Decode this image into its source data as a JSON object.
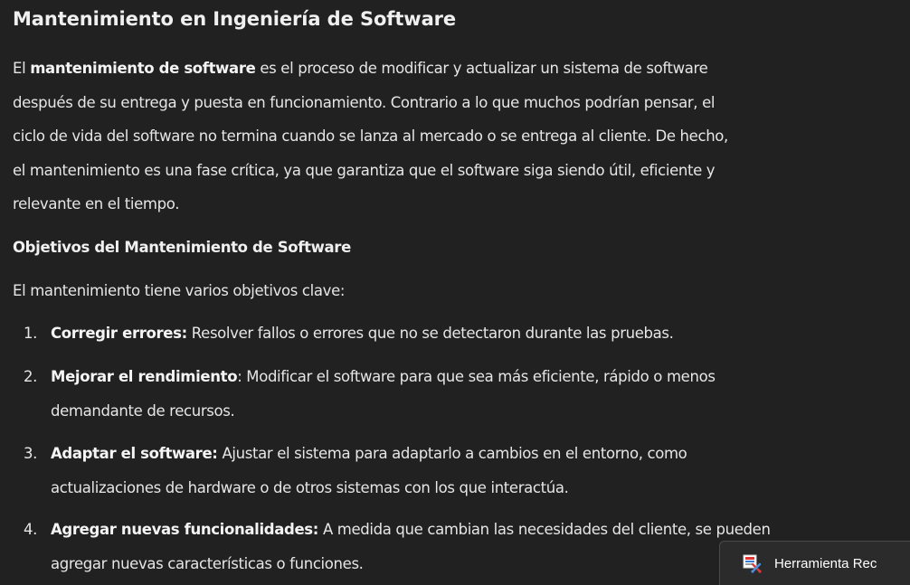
{
  "title": "Mantenimiento en Ingeniería de Software",
  "intro": {
    "line1_pre": "El ",
    "line1_bold": "mantenimiento de software",
    "line1_post": " es el proceso de modificar y actualizar un sistema de software",
    "line2": "después de su entrega y puesta en funcionamiento. Contrario a lo que muchos podrían pensar, el",
    "line3": "ciclo de vida del software no termina cuando se lanza al mercado o se entrega al cliente. De hecho,",
    "line4": "el mantenimiento es una fase crítica, ya que garantiza que el software siga siendo útil, eficiente y",
    "line5": "relevante en el tiempo."
  },
  "objectives": {
    "heading": "Objetivos del Mantenimiento de Software",
    "lead": "El mantenimiento tiene varios objetivos clave:",
    "items": [
      {
        "number": "1.",
        "title": "Corregir errores:",
        "lines": [
          "Resolver fallos o errores que no se detectaron durante las pruebas."
        ]
      },
      {
        "number": "2.",
        "title": "Mejorar el rendimiento",
        "lines": [
          ": Modificar el software para que sea más eficiente, rápido o menos",
          "demandante de recursos."
        ]
      },
      {
        "number": "3.",
        "title": "Adaptar el software:",
        "lines": [
          "Ajustar el sistema para adaptarlo a cambios en el entorno, como",
          "actualizaciones de hardware o de otros sistemas con los que interactúa."
        ]
      },
      {
        "number": "4.",
        "title": "Agregar nuevas funcionalidades:",
        "lines": [
          "A medida que cambian las necesidades del cliente, se pueden",
          "agregar nuevas características o funciones."
        ]
      }
    ]
  },
  "taskbar_tooltip": {
    "icon": "snipping-tool-icon",
    "label": "Herramienta Rec"
  }
}
